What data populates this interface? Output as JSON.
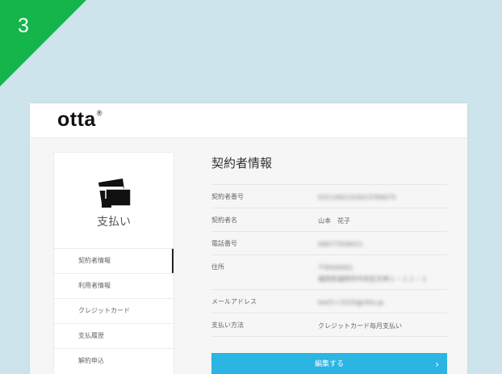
{
  "step": "3",
  "logo": {
    "text": "otta",
    "mark": "®"
  },
  "sidebar": {
    "heading": "支払い",
    "items": [
      {
        "label": "契約者情報",
        "active": true
      },
      {
        "label": "利用者情報",
        "active": false
      },
      {
        "label": "クレジットカード",
        "active": false
      },
      {
        "label": "支払履歴",
        "active": false
      },
      {
        "label": "解約申込",
        "active": false
      }
    ]
  },
  "content": {
    "title": "契約者情報",
    "rows": [
      {
        "label": "契約者番号",
        "value": "0311492103023789075"
      },
      {
        "label": "契約者名",
        "value": "山本　花子"
      },
      {
        "label": "電話番号",
        "value": "09077939011"
      },
      {
        "label": "住所",
        "value": "〒8500001",
        "value2": "福岡県福岡市中央区天神１－１１－１"
      },
      {
        "label": "メールアドレス",
        "value": "test1+1020@otta.jp"
      },
      {
        "label": "支払い方法",
        "value": "クレジットカード毎月支払い"
      }
    ],
    "edit_button": "編集する"
  },
  "colors": {
    "badge": "#14b64c",
    "button": "#2bb5e3",
    "background": "#cde4ec"
  },
  "icons": {
    "payment": "payment-cards-icon",
    "chevron": "chevron-right-icon"
  }
}
